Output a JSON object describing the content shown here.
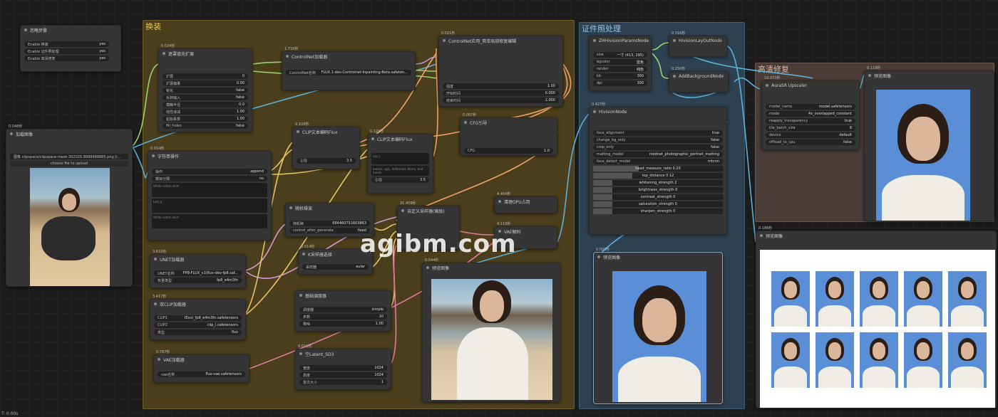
{
  "groups": {
    "main": "换装",
    "id": "证件照处理",
    "hd": "高清修复"
  },
  "watermark": "agibm.com",
  "bottom_status": "T: 0.00s",
  "nodes": {
    "skip": {
      "title": "忽略步骤",
      "rows": [
        {
          "label": "Enable 换装",
          "value": "yes"
        },
        {
          "label": "Enable 证件照处理",
          "value": "yes"
        },
        {
          "label": "Enable 高清修复",
          "value": "yes"
        }
      ]
    },
    "loadimg": {
      "badge": "0.048秒",
      "title": "加载图像",
      "image": "图像  clipspace/clipspace-mask-302025.8999999985.png [i...",
      "upload": "choose file to upload"
    },
    "outpaint": {
      "badge": "0.024秒",
      "title": "遮罩填充扩展",
      "rows": [
        {
          "label": "扩展",
          "value": "0"
        },
        {
          "label": "扩展偏量",
          "value": "0.00"
        },
        {
          "label": "锐化",
          "value": "false"
        },
        {
          "label": "反转输入",
          "value": "false"
        },
        {
          "label": "模糊半径",
          "value": "0.0"
        },
        {
          "label": "线性递减",
          "value": "1.00"
        },
        {
          "label": "起始系数",
          "value": "1.00"
        },
        {
          "label": "fill_holes",
          "value": "false"
        }
      ]
    },
    "controlnetloader": {
      "badge": "1.716秒",
      "title": "ControlNet加载器",
      "row": {
        "label": "ControlNet名称",
        "value": "FLUX.1-dev-Controlnet-Inpainting-Beta.safeten..."
      }
    },
    "cnapply": {
      "badge": "0.021秒",
      "title": "ControlNet应用_简单局部修复编辑",
      "rows": [
        {
          "label": "强度",
          "value": "1.00"
        },
        {
          "label": "开始时间",
          "value": "0.000"
        },
        {
          "label": "结束时间",
          "value": "1.000"
        }
      ]
    },
    "strop": {
      "badge": "0.014秒",
      "title": "字符串操作",
      "rows": [
        {
          "label": "操作",
          "value": "append"
        },
        {
          "label": "数目分隔",
          "value": "no"
        }
      ],
      "ta1": "White cotton shirt",
      "ta2": "text_b",
      "ta3": "White cotton shirt"
    },
    "clip1": {
      "badge": "0.103秒",
      "title": "CLIP文本编码Flux",
      "row": {
        "label": "引导",
        "value": "3.5"
      }
    },
    "clip2": {
      "badge": "0.129秒",
      "title": "CLIP文本编码Flux",
      "ta1": "clip_l",
      "ta2": "lowres, ugly, deformed, blurry, bad hands",
      "row": {
        "label": "引导",
        "value": "3.5"
      }
    },
    "cfg": {
      "badge": "0.007秒",
      "title": "CFG引导",
      "row": {
        "label": "CFG",
        "value": "1.0"
      }
    },
    "noise": {
      "title": "随机噪波",
      "rows": [
        {
          "label": "随机种",
          "value": "664460751603863"
        },
        {
          "label": "control_after_generate",
          "value": "fixed"
        }
      ]
    },
    "sampler_adv": {
      "badge": "31.409秒",
      "title": "自定义采样器(高级)"
    },
    "unet": {
      "badge": "3.618秒",
      "title": "UNET加载器",
      "rows": [
        {
          "label": "UNET名称",
          "value": "FP8-FLUX_v1\\flux-dev-fp8.saf..."
        },
        {
          "label": "权重类型",
          "value": "fp8_e4m3fn"
        }
      ]
    },
    "ksampsel": {
      "badge": "0.014秒",
      "title": "K采样器选择",
      "row": {
        "label": "采样器",
        "value": "euler"
      }
    },
    "gpu": {
      "badge": "4.404秒",
      "title": "清理GPU占用"
    },
    "vaedecode": {
      "badge": "4.110秒",
      "title": "VAE解码"
    },
    "dualclip": {
      "badge": "3.417秒",
      "title": "双CLIP加载器",
      "rows": [
        {
          "label": "CLIP1",
          "value": "t5xxl_fp8_e4m3fn.safetensors"
        },
        {
          "label": "CLIP2",
          "value": "clip_l.safetensors"
        },
        {
          "label": "类型",
          "value": "flux"
        }
      ]
    },
    "sched": {
      "title": "基础调度器",
      "rows": [
        {
          "label": "调度器",
          "value": "simple"
        },
        {
          "label": "步数",
          "value": "10"
        },
        {
          "label": "降噪",
          "value": "1.00"
        }
      ]
    },
    "preview1": {
      "badge": "0.044秒",
      "title": "预览图像"
    },
    "vaeload": {
      "badge": "0.767秒",
      "title": "VAE加载器",
      "row": {
        "label": "vae名称",
        "value": "flux-vae.safetensors"
      }
    },
    "latent": {
      "badge": "0.011秒",
      "title": "空Latent_SD3",
      "rows": [
        {
          "label": "宽度",
          "value": "1024"
        },
        {
          "label": "高度",
          "value": "1024"
        },
        {
          "label": "批次大小",
          "value": "1"
        }
      ]
    },
    "zhparams": {
      "title": "ZHHivisionParamsNode",
      "rows": [
        {
          "label": "size",
          "value": "一寸 (413, 295)"
        },
        {
          "label": "bgcolor",
          "value": "蓝色"
        },
        {
          "label": "render",
          "value": "纯色"
        },
        {
          "label": "kb",
          "value": "300"
        },
        {
          "label": "dpi",
          "value": "300"
        }
      ]
    },
    "layout": {
      "badge": "0.316秒",
      "title": "HivisionLayOutNode"
    },
    "addbg": {
      "badge": "0.250秒",
      "title": "AddBackgroundNode"
    },
    "hivision": {
      "badge": "0.427秒",
      "title": "HivisionNode",
      "rows": [
        {
          "label": "face_alignment",
          "value": "true"
        },
        {
          "label": "change_bg_only",
          "value": "false"
        },
        {
          "label": "crop_only",
          "value": "false"
        },
        {
          "label": "matting_model",
          "value": "modnet_photographic_portrait_matting"
        },
        {
          "label": "face_detect_model",
          "value": "mtcnn"
        }
      ],
      "sliders": [
        {
          "label": "head_measure_ratio",
          "value": "0.20",
          "fill": 0.35
        },
        {
          "label": "top_distance",
          "value": "0.12",
          "fill": 0.3
        },
        {
          "label": "whitening_strength",
          "value": "2",
          "fill": 0.15
        },
        {
          "label": "brightness_strength",
          "value": "0",
          "fill": 0.15
        },
        {
          "label": "contrast_strength",
          "value": "0",
          "fill": 0.15
        },
        {
          "label": "saturation_strength",
          "value": "0",
          "fill": 0.15
        },
        {
          "label": "sharpen_strength",
          "value": "0",
          "fill": 0.15
        }
      ]
    },
    "preview_id": {
      "badge": "0.003秒",
      "title": "预览图像"
    },
    "aura": {
      "badge": "19.071秒",
      "title": "AuraSR Upscaler",
      "rows": [
        {
          "label": "model_name",
          "value": "model.safetensors"
        },
        {
          "label": "mode",
          "value": "4x_overlapped_constant"
        },
        {
          "label": "reapply_transparency",
          "value": "true"
        },
        {
          "label": "tile_batch_size",
          "value": "8"
        },
        {
          "label": "device",
          "value": "default"
        },
        {
          "label": "offload_to_cpu",
          "value": "false"
        }
      ]
    },
    "preview_hd": {
      "badge": "0.118秒",
      "title": "预览图像"
    },
    "preview_layout": {
      "badge": "0.186秒",
      "title": "预览图像"
    }
  }
}
